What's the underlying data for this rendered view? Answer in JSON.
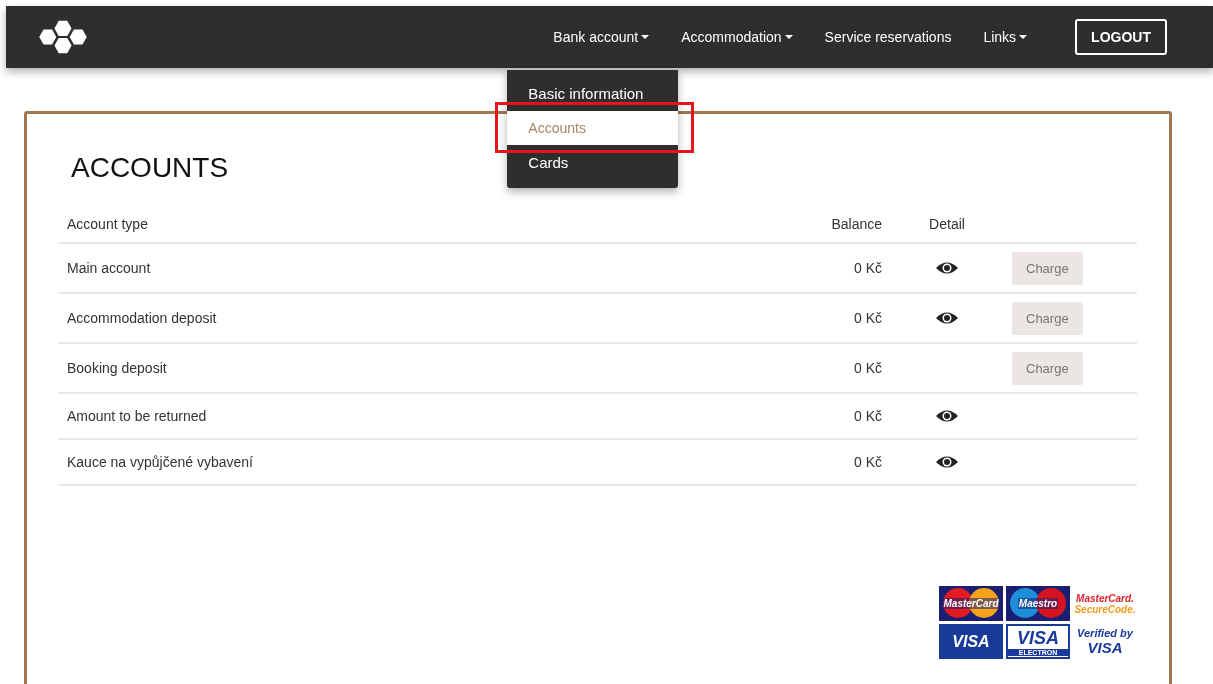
{
  "nav": {
    "items": [
      {
        "label": "Bank account",
        "dropdown": true,
        "menu": [
          {
            "label": "Basic information",
            "selected": false,
            "highlighted": false
          },
          {
            "label": "Accounts",
            "selected": true,
            "highlighted": true
          },
          {
            "label": "Cards",
            "selected": false,
            "highlighted": false
          }
        ]
      },
      {
        "label": "Accommodation",
        "dropdown": true
      },
      {
        "label": "Service reservations",
        "dropdown": false
      },
      {
        "label": "Links",
        "dropdown": true
      }
    ],
    "logout": "LOGOUT"
  },
  "title": "ACCOUNTS",
  "table": {
    "columns": [
      "Account type",
      "Balance",
      "Detail"
    ],
    "rows": [
      {
        "account_type": "Main account",
        "balance": "0 Kč",
        "detail": true,
        "charge": "Charge"
      },
      {
        "account_type": "Accommodation deposit",
        "balance": "0 Kč",
        "detail": true,
        "charge": "Charge"
      },
      {
        "account_type": "Booking deposit",
        "balance": "0 Kč",
        "detail": false,
        "charge": "Charge"
      },
      {
        "account_type": "Amount to be returned",
        "balance": "0 Kč",
        "detail": true
      },
      {
        "account_type": "Kauce na vypůjčené vybavení",
        "balance": "0 Kč",
        "detail": true
      }
    ]
  },
  "payment_logos": [
    {
      "kind": "mastercard",
      "texts": [
        "MasterCard"
      ]
    },
    {
      "kind": "maestro",
      "texts": [
        "Maestro"
      ]
    },
    {
      "kind": "securecode",
      "texts": [
        "MasterCard.",
        "SecureCode."
      ]
    },
    {
      "kind": "visa",
      "texts": [
        "VISA"
      ]
    },
    {
      "kind": "electron",
      "texts": [
        "VISA",
        "ELECTRON"
      ]
    },
    {
      "kind": "verified",
      "texts": [
        "Verified by",
        "VISA"
      ]
    }
  ]
}
